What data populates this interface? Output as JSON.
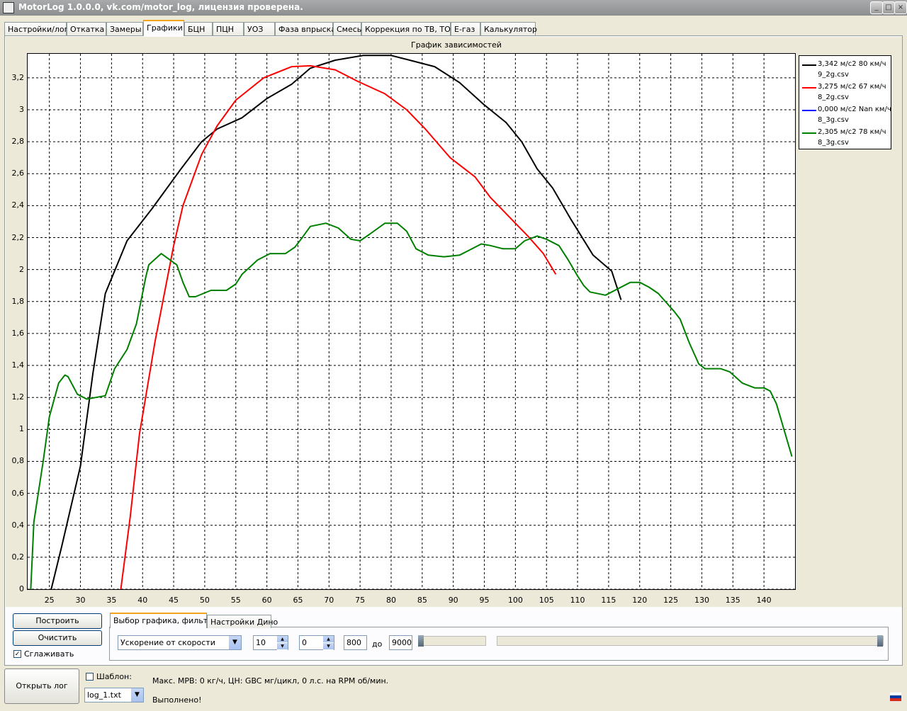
{
  "window": {
    "title": "MotorLog 1.0.0.0, vk.com/motor_log, лицензия проверена."
  },
  "tabs": [
    {
      "label": "Настройки/лог"
    },
    {
      "label": "Откатка"
    },
    {
      "label": "Замеры"
    },
    {
      "label": "Графики"
    },
    {
      "label": "БЦН"
    },
    {
      "label": "ПЦН"
    },
    {
      "label": "УОЗ"
    },
    {
      "label": "Фаза впрыска"
    },
    {
      "label": "Смесь"
    },
    {
      "label": "Коррекция по ТВ, ТОЖ"
    },
    {
      "label": "E-газ"
    },
    {
      "label": "Калькулятор"
    }
  ],
  "active_tab": "Графики",
  "chart_data": {
    "type": "line",
    "title": "График зависимостей",
    "xlabel": "",
    "ylabel": "",
    "xlim": [
      21.5,
      145
    ],
    "ylim": [
      0,
      3.35
    ],
    "grid": true,
    "legend_position": "right",
    "x_ticks": [
      "25",
      "30",
      "35",
      "40",
      "45",
      "50",
      "55",
      "60",
      "65",
      "70",
      "75",
      "80",
      "85",
      "90",
      "95",
      "100",
      "105",
      "110",
      "115",
      "120",
      "125",
      "130",
      "135",
      "140"
    ],
    "y_ticks": [
      "0",
      "0,2",
      "0,4",
      "0,6",
      "0,8",
      "1",
      "1,2",
      "1,4",
      "1,6",
      "1,8",
      "2",
      "2,2",
      "2,4",
      "2,6",
      "2,8",
      "3",
      "3,2"
    ],
    "legend": [
      {
        "line1": "3,342 м/с2 80 км/ч",
        "line2": "9_2g.csv",
        "color": "#000000"
      },
      {
        "line1": "3,275 м/с2 67 км/ч",
        "line2": "8_2g.csv",
        "color": "#ff0000"
      },
      {
        "line1": "0,000 м/с2 Nan км/ч",
        "line2": "8_3g.csv",
        "color": "#0000ff"
      },
      {
        "line1": "2,305 м/с2 78 км/ч",
        "line2": "8_3g.csv",
        "color": "#008000"
      }
    ],
    "series": [
      {
        "color": "#000000",
        "points": [
          [
            25.3,
            0
          ],
          [
            27,
            0.27
          ],
          [
            30,
            0.77
          ],
          [
            32,
            1.35
          ],
          [
            34,
            1.85
          ],
          [
            37.5,
            2.18
          ],
          [
            41.5,
            2.38
          ],
          [
            46,
            2.62
          ],
          [
            49.5,
            2.8
          ],
          [
            52,
            2.88
          ],
          [
            56,
            2.95
          ],
          [
            60,
            3.07
          ],
          [
            64,
            3.16
          ],
          [
            67,
            3.26
          ],
          [
            71,
            3.31
          ],
          [
            75.5,
            3.34
          ],
          [
            80,
            3.34
          ],
          [
            83,
            3.31
          ],
          [
            87,
            3.27
          ],
          [
            91,
            3.17
          ],
          [
            95,
            3.03
          ],
          [
            98.5,
            2.92
          ],
          [
            101,
            2.8
          ],
          [
            103.5,
            2.63
          ],
          [
            106,
            2.51
          ],
          [
            109,
            2.31
          ],
          [
            112.5,
            2.09
          ],
          [
            115.5,
            1.99
          ],
          [
            117,
            1.81
          ]
        ]
      },
      {
        "color": "#ff0000",
        "points": [
          [
            36.5,
            0
          ],
          [
            38,
            0.45
          ],
          [
            39.5,
            0.97
          ],
          [
            42,
            1.55
          ],
          [
            45,
            2.15
          ],
          [
            46.5,
            2.4
          ],
          [
            49.5,
            2.72
          ],
          [
            52,
            2.9
          ],
          [
            55,
            3.06
          ],
          [
            59.5,
            3.2
          ],
          [
            64,
            3.27
          ],
          [
            67,
            3.275
          ],
          [
            71,
            3.25
          ],
          [
            74.5,
            3.18
          ],
          [
            79,
            3.1
          ],
          [
            82.5,
            3
          ],
          [
            85.5,
            2.88
          ],
          [
            89.5,
            2.7
          ],
          [
            93.5,
            2.58
          ],
          [
            96,
            2.45
          ],
          [
            99,
            2.33
          ],
          [
            102,
            2.21
          ],
          [
            104.5,
            2.1
          ],
          [
            106.5,
            1.97
          ]
        ]
      },
      {
        "color": "#008000",
        "points": [
          [
            22,
            0
          ],
          [
            22.5,
            0.42
          ],
          [
            24,
            0.8
          ],
          [
            25,
            1.08
          ],
          [
            26.5,
            1.29
          ],
          [
            27.5,
            1.34
          ],
          [
            28,
            1.33
          ],
          [
            29.5,
            1.22
          ],
          [
            31,
            1.19
          ],
          [
            32.5,
            1.2
          ],
          [
            34,
            1.21
          ],
          [
            35.5,
            1.38
          ],
          [
            37.5,
            1.5
          ],
          [
            39,
            1.66
          ],
          [
            40.5,
            1.95
          ],
          [
            41,
            2.03
          ],
          [
            43,
            2.1
          ],
          [
            45.5,
            2.03
          ],
          [
            46.5,
            1.92
          ],
          [
            47.5,
            1.83
          ],
          [
            48.5,
            1.83
          ],
          [
            51,
            1.87
          ],
          [
            53.5,
            1.87
          ],
          [
            55,
            1.91
          ],
          [
            56,
            1.97
          ],
          [
            58.5,
            2.06
          ],
          [
            60.5,
            2.1
          ],
          [
            63,
            2.1
          ],
          [
            64.5,
            2.14
          ],
          [
            65.5,
            2.19
          ],
          [
            67,
            2.27
          ],
          [
            69.5,
            2.29
          ],
          [
            71.5,
            2.26
          ],
          [
            73.5,
            2.19
          ],
          [
            75,
            2.18
          ],
          [
            76.5,
            2.22
          ],
          [
            79,
            2.29
          ],
          [
            81,
            2.29
          ],
          [
            82.5,
            2.24
          ],
          [
            84,
            2.13
          ],
          [
            86,
            2.09
          ],
          [
            88.5,
            2.08
          ],
          [
            91,
            2.09
          ],
          [
            92.5,
            2.12
          ],
          [
            94.5,
            2.16
          ],
          [
            96,
            2.15
          ],
          [
            98,
            2.13
          ],
          [
            100,
            2.13
          ],
          [
            101.5,
            2.18
          ],
          [
            103.5,
            2.21
          ],
          [
            105,
            2.19
          ],
          [
            107,
            2.15
          ],
          [
            108.5,
            2.06
          ],
          [
            110,
            1.96
          ],
          [
            111,
            1.9
          ],
          [
            112,
            1.86
          ],
          [
            114.5,
            1.84
          ],
          [
            116,
            1.87
          ],
          [
            118.5,
            1.92
          ],
          [
            120,
            1.92
          ],
          [
            121.5,
            1.89
          ],
          [
            123,
            1.85
          ],
          [
            125.5,
            1.74
          ],
          [
            126.5,
            1.69
          ],
          [
            128,
            1.54
          ],
          [
            129.5,
            1.41
          ],
          [
            130.5,
            1.38
          ],
          [
            133,
            1.38
          ],
          [
            134.5,
            1.36
          ],
          [
            136.5,
            1.29
          ],
          [
            138.5,
            1.26
          ],
          [
            140,
            1.26
          ],
          [
            141,
            1.24
          ],
          [
            142,
            1.16
          ],
          [
            144.5,
            0.83
          ]
        ]
      }
    ]
  },
  "controls": {
    "build_button": "Построить",
    "clear_button": "Очистить",
    "smooth_label": "Сглаживать",
    "smooth_checked": true,
    "subtabs": [
      {
        "label": "Выбор графика, фильтр"
      },
      {
        "label": "Настройки Дино"
      }
    ],
    "graph_select": "Ускорение от скорости",
    "spin1": "10",
    "spin2": "0",
    "rpm_from": "800",
    "to_label": "до",
    "rpm_to": "9000"
  },
  "bottom": {
    "open_log_button": "Открыть лог",
    "template_label": "Шаблон:",
    "template_checked": false,
    "log_select": "log_1.txt",
    "status_line1": "Макс. МРВ: 0 кг/ч, ЦН: GBC мг/цикл, 0 л.с. на RPM об/мин.",
    "status_line2": "Выполнено!"
  }
}
